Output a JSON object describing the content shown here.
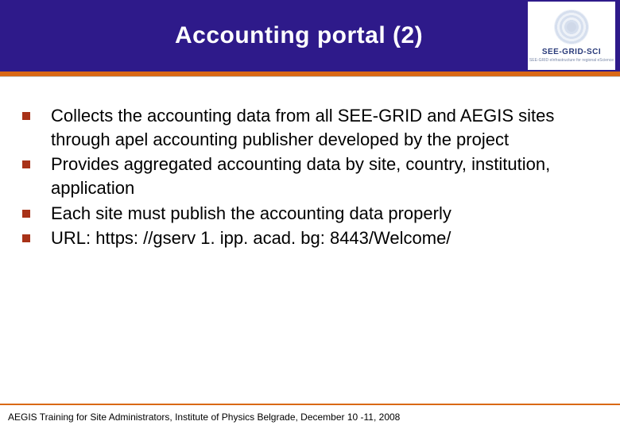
{
  "slide": {
    "title": "Accounting portal (2)",
    "logo": {
      "text": "SEE-GRID-SCI",
      "subtext": "SEE-GRID eInfrastructure for regional eScience"
    },
    "bullets": [
      "Collects the accounting data from all SEE-GRID and AEGIS sites through apel accounting publisher developed by the project",
      "Provides aggregated accounting data by site, country, institution, application",
      "Each site must publish the accounting data properly",
      "URL: https: //gserv 1. ipp. acad. bg: 8443/Welcome/"
    ],
    "footer": "AEGIS Training for Site Administrators, Institute of Physics Belgrade, December 10 -11, 2008"
  }
}
